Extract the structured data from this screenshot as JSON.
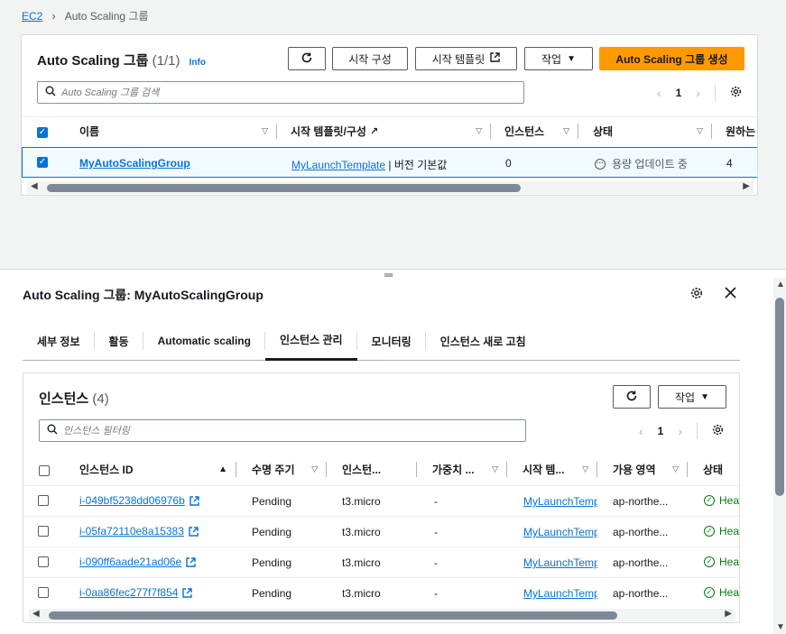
{
  "breadcrumb": {
    "root": "EC2",
    "current": "Auto Scaling 그룹"
  },
  "top": {
    "title": "Auto Scaling 그룹",
    "count": "(1/1)",
    "info": "Info",
    "buttons": {
      "launch_config": "시작 구성",
      "launch_template": "시작 템플릿",
      "actions": "작업",
      "create": "Auto Scaling 그룹 생성"
    },
    "search_placeholder": "Auto Scaling 그룹 검색",
    "page": "1",
    "columns": [
      "이름",
      "시작 템플릿/구성",
      "인스턴스",
      "상태",
      "원하는"
    ],
    "row": {
      "name": "MyAutoScalingGroup",
      "template": "MyLaunchTemplate",
      "version": " | 버전 기본값",
      "instances": "0",
      "status": "용량 업데이트 중",
      "desired": "4"
    }
  },
  "detail": {
    "title": "Auto Scaling 그룹: MyAutoScalingGroup",
    "tabs": [
      "세부 정보",
      "활동",
      "Automatic scaling",
      "인스턴스 관리",
      "모니터링",
      "인스턴스 새로 고침"
    ],
    "active_tab": "인스턴스 관리"
  },
  "instances": {
    "title": "인스턴스",
    "count": "(4)",
    "actions": "작업",
    "filter_placeholder": "인스턴스 필터링",
    "page": "1",
    "columns": [
      "인스턴스 ID",
      "수명 주기",
      "인스턴...",
      "가중치 ...",
      "시작 템...",
      "가용 영역",
      "상태"
    ],
    "rows": [
      {
        "id": "i-049bf5238dd06976b",
        "lifecycle": "Pending",
        "type": "t3.micro",
        "weight": "-",
        "template": "MyLaunchTemp",
        "az": "ap-northe...",
        "health": "Hea"
      },
      {
        "id": "i-05fa72110e8a15383",
        "lifecycle": "Pending",
        "type": "t3.micro",
        "weight": "-",
        "template": "MyLaunchTemp",
        "az": "ap-northe...",
        "health": "Hea"
      },
      {
        "id": "i-090ff6aade21ad06e",
        "lifecycle": "Pending",
        "type": "t3.micro",
        "weight": "-",
        "template": "MyLaunchTemp",
        "az": "ap-northe...",
        "health": "Hea"
      },
      {
        "id": "i-0aa86fec277f7f854",
        "lifecycle": "Pending",
        "type": "t3.micro",
        "weight": "-",
        "template": "MyLaunchTemp",
        "az": "ap-northe...",
        "health": "Hea"
      }
    ]
  },
  "colors": {
    "link": "#0972d3",
    "primary": "#ff9900",
    "success": "#037f0c"
  }
}
